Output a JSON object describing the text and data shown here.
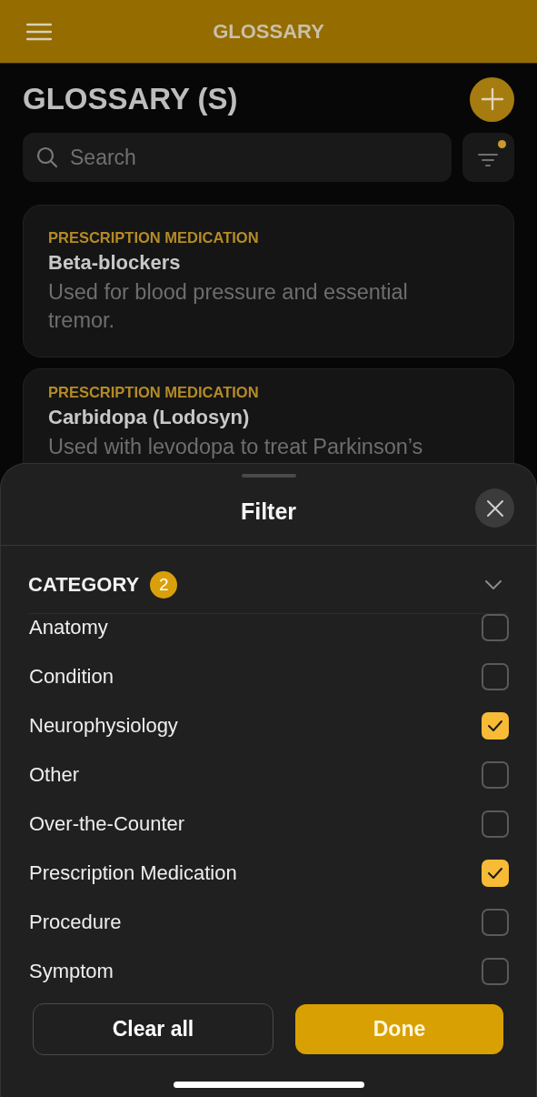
{
  "header": {
    "title": "GLOSSARY"
  },
  "page": {
    "title": "GLOSSARY (S)",
    "search": {
      "placeholder": "Search"
    },
    "filter_active": true
  },
  "cards": [
    {
      "category": "PRESCRIPTION MEDICATION",
      "term": "Beta-blockers",
      "description": "Used for blood pressure and essential tremor."
    },
    {
      "category": "PRESCRIPTION MEDICATION",
      "term": "Carbidopa (Lodosyn)",
      "description": "Used with levodopa to treat Parkinson’s"
    }
  ],
  "filter_sheet": {
    "title": "Filter",
    "section": {
      "label": "CATEGORY",
      "count": "2"
    },
    "items": [
      {
        "label": "Anatomy",
        "checked": false
      },
      {
        "label": "Condition",
        "checked": false
      },
      {
        "label": "Neurophysiology",
        "checked": true
      },
      {
        "label": "Other",
        "checked": false
      },
      {
        "label": "Over-the-Counter",
        "checked": false
      },
      {
        "label": "Prescription Medication",
        "checked": true
      },
      {
        "label": "Procedure",
        "checked": false
      },
      {
        "label": "Symptom",
        "checked": false
      }
    ],
    "buttons": [
      {
        "label": "Clear all",
        "kind": "secondary"
      },
      {
        "label": "Done",
        "kind": "primary"
      }
    ]
  }
}
